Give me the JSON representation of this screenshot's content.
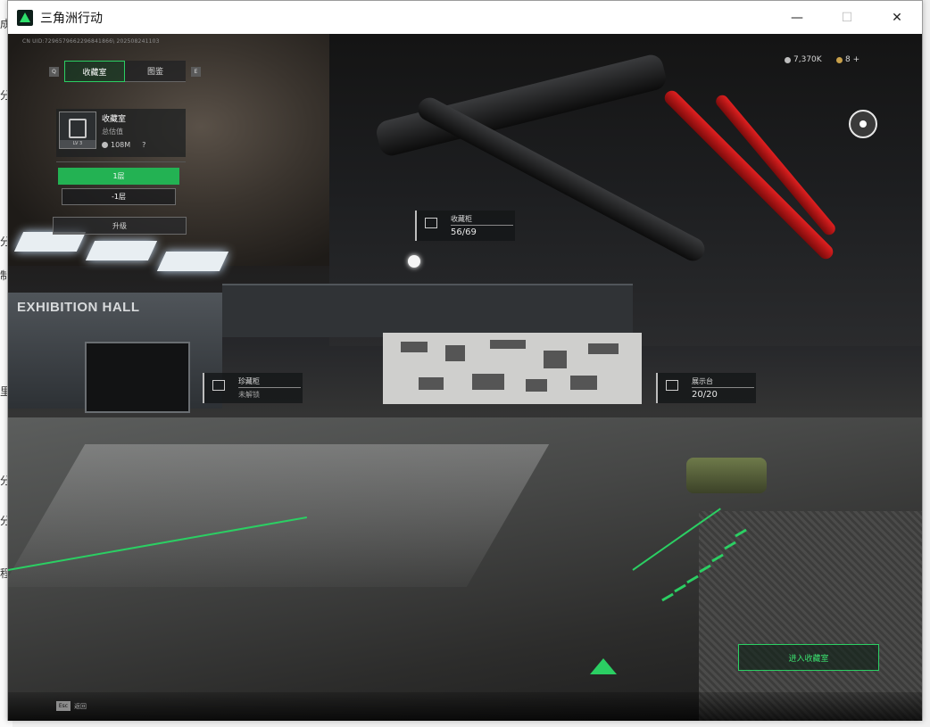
{
  "window": {
    "title": "三角洲行动",
    "controls": {
      "minimize": "—",
      "maximize": "☐",
      "close": "✕"
    }
  },
  "desktop_edge": [
    "成",
    "分",
    "分",
    "制",
    "里",
    "分",
    "分",
    "程"
  ],
  "hud": {
    "uid": "CN UID:7296579662296841866\\ 202508241103",
    "currency": [
      {
        "icon": "silver-coin-icon",
        "value": "7,370K"
      },
      {
        "icon": "gold-coin-icon",
        "value": "8 +"
      }
    ],
    "tabs": [
      {
        "label": "收藏室",
        "active": true
      },
      {
        "label": "图鉴",
        "active": false
      }
    ],
    "key_left": "Q",
    "key_right": "E"
  },
  "vault_panel": {
    "title": "收藏室",
    "subtitle": "总估值",
    "value": "108M",
    "level": "LV 3",
    "help": "?"
  },
  "floors": [
    {
      "label": "1层",
      "active": true
    },
    {
      "label": "-1层",
      "active": false
    }
  ],
  "upgrade_label": "升级",
  "world_labels": {
    "cabinet": {
      "title": "收藏柜",
      "value": "56/69"
    },
    "treasure": {
      "title": "珍藏柜",
      "value": "未解锁"
    },
    "display": {
      "title": "展示台",
      "value": "20/20"
    }
  },
  "scene_text": {
    "exhibition_hall": "EXHIBITION HALL"
  },
  "enter_button": "进入收藏室",
  "bottom": {
    "esc_key": "Esc",
    "esc_label": "返回"
  },
  "colors": {
    "accent": "#2bcf63",
    "panel": "#1e2022"
  }
}
